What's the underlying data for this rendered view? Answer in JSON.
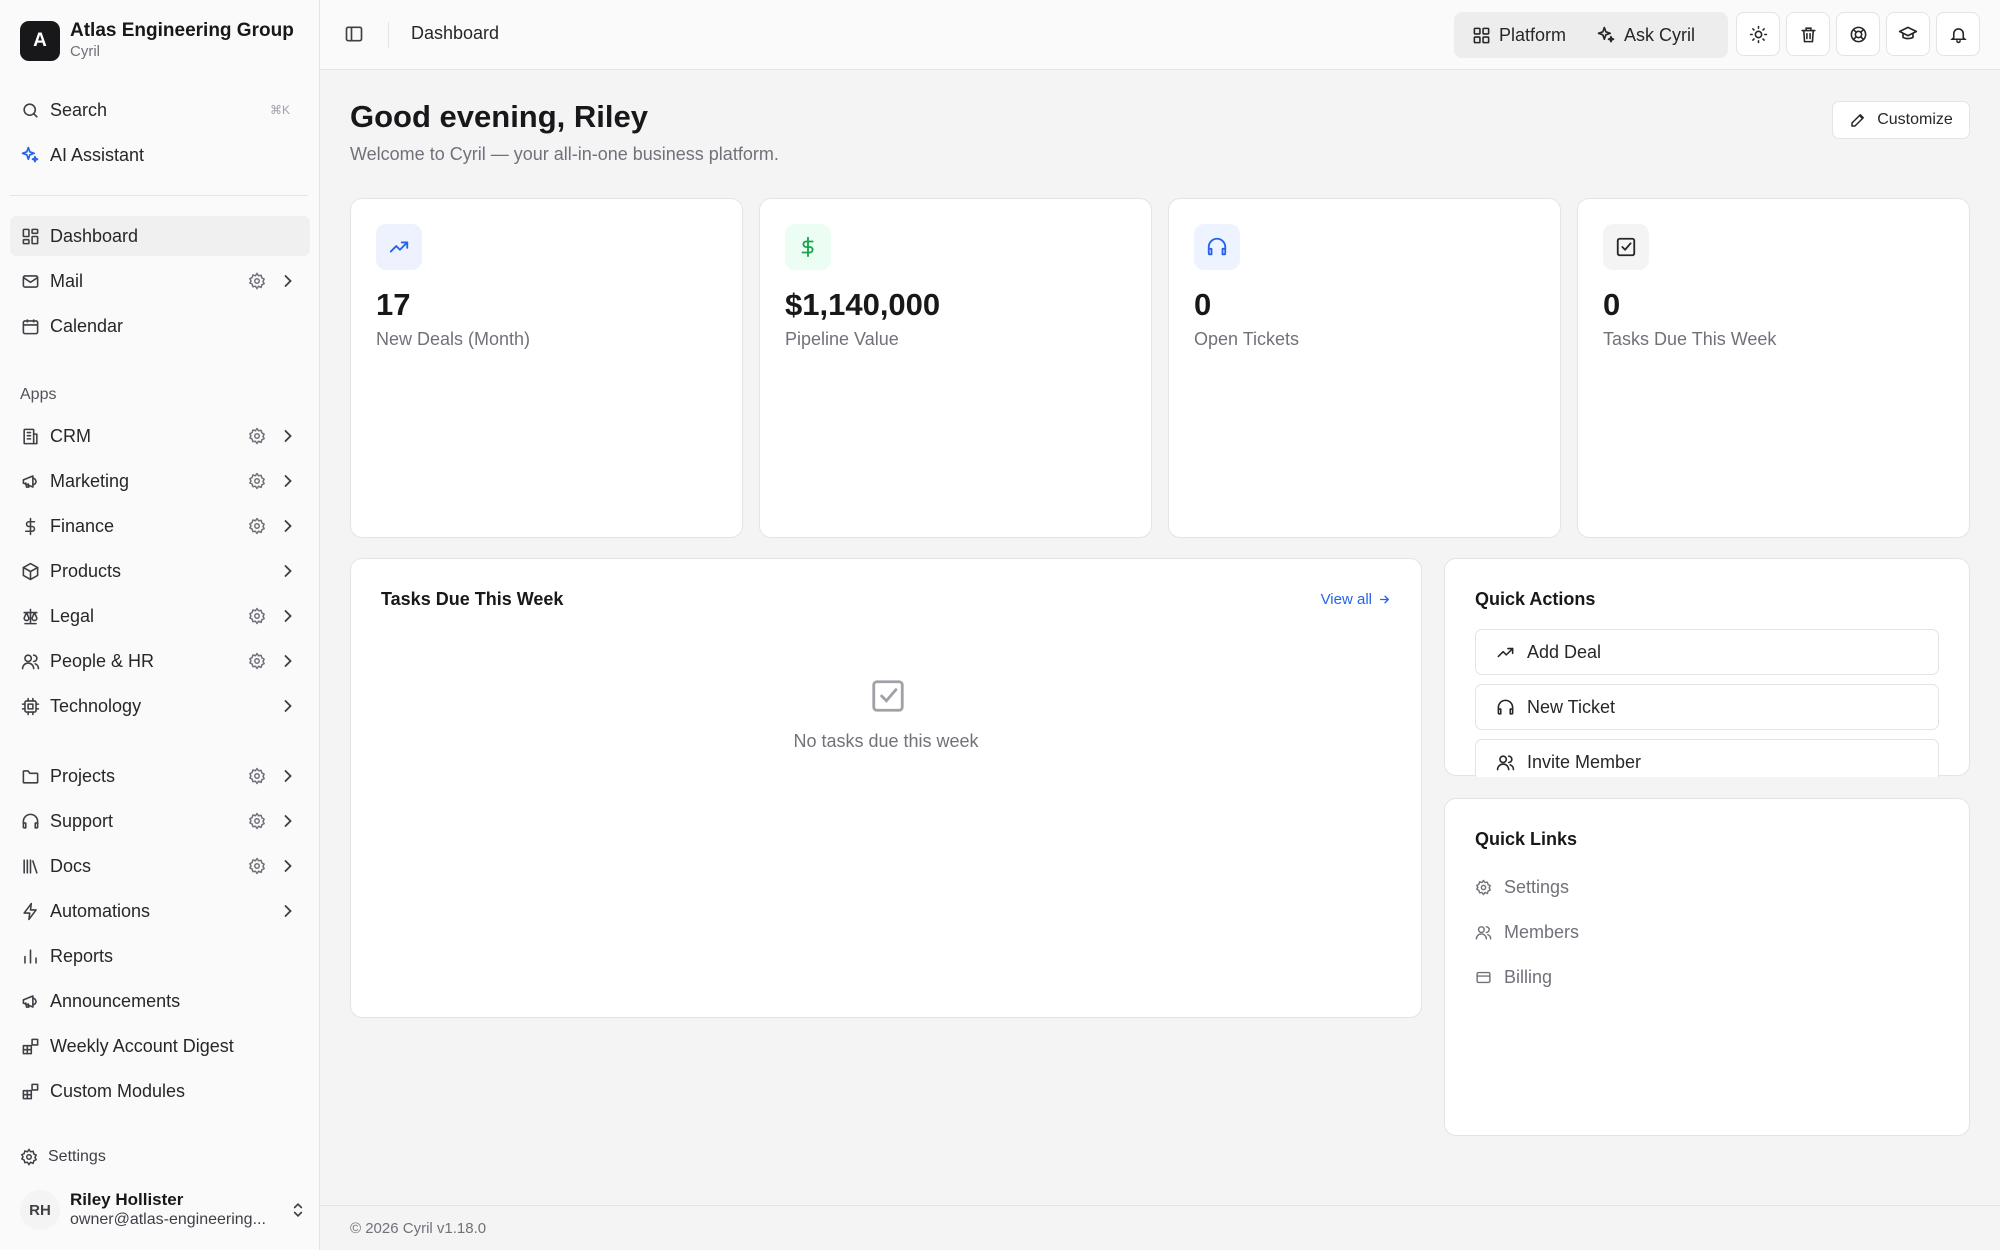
{
  "org": {
    "initial": "A",
    "name": "Atlas Engineering Group",
    "product": "Cyril"
  },
  "sidebar": {
    "top": [
      {
        "icon": "search-icon",
        "label": "Search",
        "shortcut": "⌘K"
      },
      {
        "icon": "sparkles-icon",
        "label": "AI Assistant"
      }
    ],
    "main": [
      {
        "icon": "grid-icon",
        "label": "Dashboard",
        "active": true
      },
      {
        "icon": "mail-icon",
        "label": "Mail",
        "gear": true,
        "chevron": true
      },
      {
        "icon": "calendar-icon",
        "label": "Calendar"
      }
    ],
    "apps_label": "Apps",
    "apps": [
      {
        "icon": "building-icon",
        "label": "CRM",
        "gear": true
      },
      {
        "icon": "megaphone-icon",
        "label": "Marketing",
        "gear": true
      },
      {
        "icon": "dollar-icon",
        "label": "Finance",
        "gear": true
      },
      {
        "icon": "package-icon",
        "label": "Products",
        "gear": false
      },
      {
        "icon": "scale-icon",
        "label": "Legal",
        "gear": true
      },
      {
        "icon": "users-icon",
        "label": "People & HR",
        "gear": true
      },
      {
        "icon": "cpu-icon",
        "label": "Technology",
        "gear": false
      }
    ],
    "more": [
      {
        "icon": "folder-icon",
        "label": "Projects",
        "gear": true,
        "chevron": true
      },
      {
        "icon": "headphones-icon",
        "label": "Support",
        "gear": true,
        "chevron": true
      },
      {
        "icon": "library-icon",
        "label": "Docs",
        "gear": true,
        "chevron": true
      },
      {
        "icon": "zap-icon",
        "label": "Automations",
        "gear": false,
        "chevron": true
      },
      {
        "icon": "bar-chart-icon",
        "label": "Reports",
        "gear": false,
        "chevron": false
      },
      {
        "icon": "megaphone-icon",
        "label": "Announcements",
        "gear": false,
        "chevron": false
      },
      {
        "icon": "blocks-icon",
        "label": "Weekly Account Digest",
        "gear": false,
        "chevron": false
      },
      {
        "icon": "blocks-icon",
        "label": "Custom Modules",
        "gear": false,
        "chevron": false
      }
    ],
    "settings_label": "Settings",
    "user": {
      "initials": "RH",
      "name": "Riley Hollister",
      "email": "owner@atlas-engineering..."
    }
  },
  "topbar": {
    "breadcrumb": "Dashboard",
    "platform_label": "Platform",
    "ask_label": "Ask Cyril"
  },
  "main": {
    "greeting": "Good evening, Riley",
    "welcome": "Welcome to Cyril — your all-in-one business platform.",
    "customize_label": "Customize",
    "stats": [
      {
        "icon": "trending-up-icon",
        "value": "17",
        "label": "New Deals (Month)",
        "accent": "#2563eb",
        "bg": "#eef2ff"
      },
      {
        "icon": "dollar-icon",
        "value": "$1,140,000",
        "label": "Pipeline Value",
        "accent": "#16a34a",
        "bg": "#ecfdf3"
      },
      {
        "icon": "headphones-icon",
        "value": "0",
        "label": "Open Tickets",
        "accent": "#2563eb",
        "bg": "#eef4ff"
      },
      {
        "icon": "check-square-icon",
        "value": "0",
        "label": "Tasks Due This Week",
        "accent": "#27272a",
        "bg": "#f4f4f5"
      }
    ],
    "tasks": {
      "title": "Tasks Due This Week",
      "view_all": "View all",
      "empty": "No tasks due this week"
    },
    "quick_actions": {
      "title": "Quick Actions",
      "items": [
        "Add Deal",
        "New Ticket",
        "Invite Member"
      ]
    },
    "quick_links": {
      "title": "Quick Links",
      "items": [
        "Settings",
        "Members",
        "Billing"
      ]
    }
  },
  "footer": {
    "text": "© 2026 Cyril v1.18.0"
  }
}
